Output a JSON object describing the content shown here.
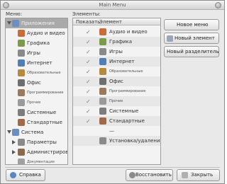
{
  "window": {
    "title": "Main Menu"
  },
  "menus_label": "Меню:",
  "items_label": "Элементы:",
  "list_header": {
    "show": "Показать",
    "item": "Элемент"
  },
  "tree": [
    {
      "label": "Приложения",
      "expander": "down",
      "selected": true,
      "icon": "#6d8fbf",
      "small": false
    },
    {
      "label": "Аудио и видео",
      "expander": "",
      "icon": "#c96c3a",
      "small": false
    },
    {
      "label": "Графика",
      "expander": "",
      "icon": "#7a9a4c",
      "small": false
    },
    {
      "label": "Игры",
      "expander": "",
      "icon": "#8a8a8a",
      "small": false
    },
    {
      "label": "Интернет",
      "expander": "",
      "icon": "#4f7fb5",
      "small": false
    },
    {
      "label": "Образовательные",
      "expander": "",
      "icon": "#b58a3c",
      "small": true
    },
    {
      "label": "Офис",
      "expander": "",
      "icon": "#6e6e6e",
      "small": false
    },
    {
      "label": "Программирование",
      "expander": "",
      "icon": "#9a7a5a",
      "small": true
    },
    {
      "label": "Прочие",
      "expander": "",
      "icon": "#9a9a9a",
      "small": true
    },
    {
      "label": "Системные",
      "expander": "",
      "icon": "#7d7d7d",
      "small": false
    },
    {
      "label": "Стандартные",
      "expander": "",
      "icon": "#a06a4a",
      "small": false
    },
    {
      "label": "Система",
      "expander": "down",
      "icon": "#6d8fbf",
      "small": false
    },
    {
      "label": "Параметры",
      "expander": "right",
      "icon": "#8a8a8a",
      "small": false
    },
    {
      "label": "Администрирован",
      "expander": "right",
      "icon": "#8a6a4a",
      "small": false
    },
    {
      "label": "Документация",
      "expander": "",
      "icon": "#a0a0a0",
      "small": true
    }
  ],
  "list": [
    {
      "checked": true,
      "label": "Аудио и видео",
      "icon": "#c96c3a",
      "small": false
    },
    {
      "checked": true,
      "label": "Графика",
      "icon": "#7a9a4c",
      "small": false
    },
    {
      "checked": true,
      "label": "Игры",
      "icon": "#8a8a8a",
      "small": false
    },
    {
      "checked": true,
      "label": "Интернет",
      "icon": "#4f7fb5",
      "small": false
    },
    {
      "checked": true,
      "label": "Образовательные",
      "icon": "#b58a3c",
      "small": true
    },
    {
      "checked": true,
      "label": "Офис",
      "icon": "#6e6e6e",
      "small": false
    },
    {
      "checked": true,
      "label": "Программирование",
      "icon": "#9a7a5a",
      "small": true
    },
    {
      "checked": true,
      "label": "Прочие",
      "icon": "#9a9a9a",
      "small": true
    },
    {
      "checked": true,
      "label": "Системные",
      "icon": "#7d7d7d",
      "small": false
    },
    {
      "checked": true,
      "label": "Стандартные",
      "icon": "#a06a4a",
      "small": false
    },
    {
      "checked": false,
      "label": "—",
      "icon": "",
      "small": false
    },
    {
      "checked": false,
      "label": "Установка/удаление",
      "icon": "#8a8a8a",
      "small": false
    }
  ],
  "buttons": {
    "new_menu": "Новое меню",
    "new_item": "Новый элемент",
    "new_separator": "Новый разделитель",
    "help": "Справка",
    "revert": "Восстановить",
    "close": "Закрыть"
  }
}
